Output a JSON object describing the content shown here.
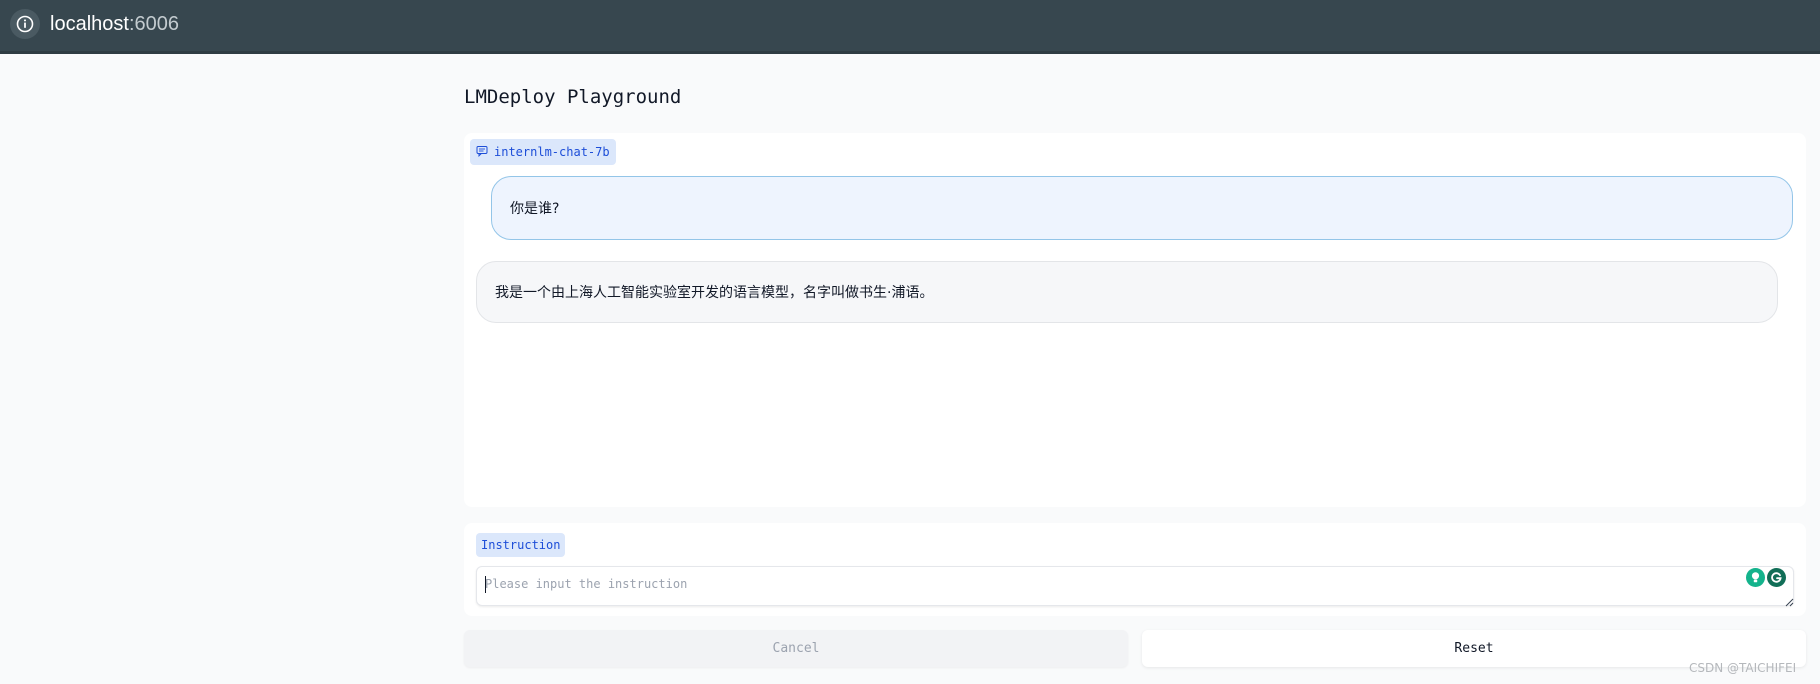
{
  "browser": {
    "url_host": "localhost",
    "url_port": ":6006",
    "info_icon": "info-icon"
  },
  "page": {
    "title": "LMDeploy Playground"
  },
  "chat": {
    "model_label": "internlm-chat-7b",
    "model_icon": "chat-bubble-icon",
    "messages": [
      {
        "role": "user",
        "text": "你是谁?"
      },
      {
        "role": "assistant",
        "text": "我是一个由上海人工智能实验室开发的语言模型，名字叫做书生·浦语。"
      }
    ]
  },
  "instruction": {
    "label": "Instruction",
    "placeholder": "Please input the instruction",
    "value": ""
  },
  "buttons": {
    "cancel": "Cancel",
    "reset": "Reset"
  },
  "watermark": "CSDN @TAICHIFEI",
  "colors": {
    "accent": "#1d4ed8",
    "badge_bg": "#dbe7fb",
    "user_bubble": "#eef4fe",
    "browser_bar": "#37474f"
  }
}
